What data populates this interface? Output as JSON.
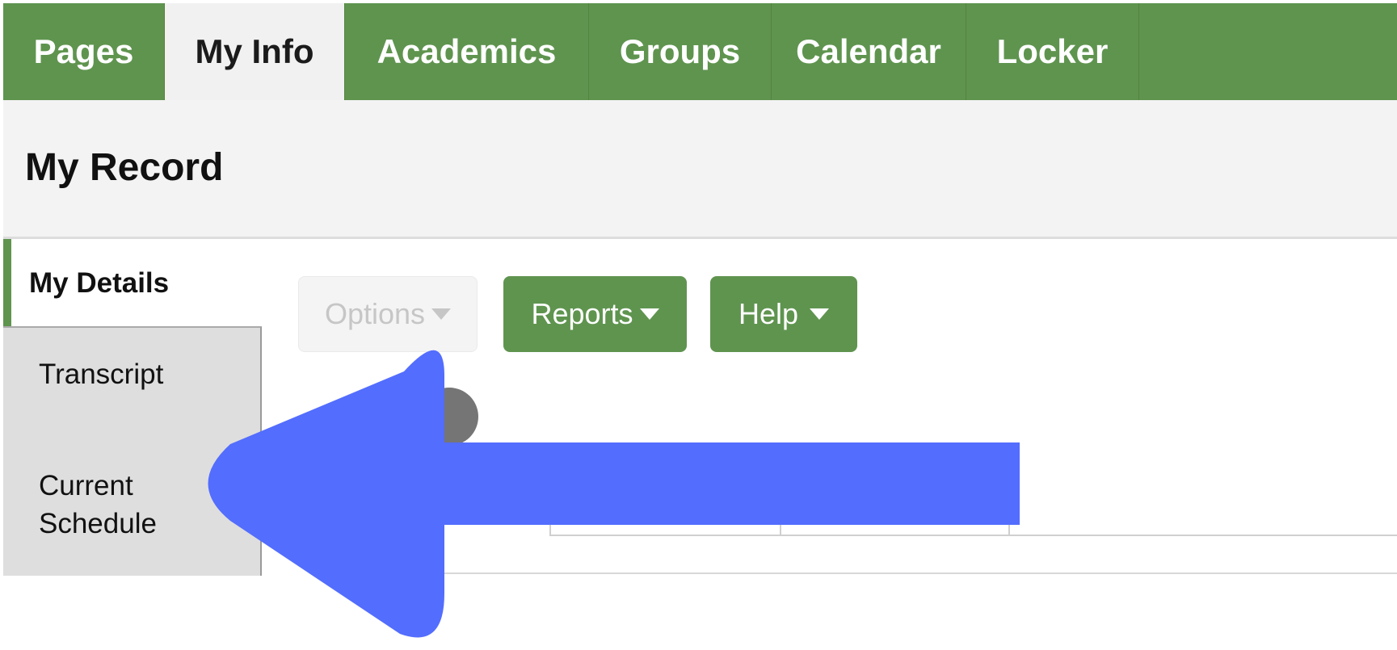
{
  "topnav": {
    "tabs": [
      {
        "label": "Pages"
      },
      {
        "label": "My Info"
      },
      {
        "label": "Academics"
      },
      {
        "label": "Groups"
      },
      {
        "label": "Calendar"
      },
      {
        "label": "Locker"
      }
    ]
  },
  "header": {
    "title": "My Record"
  },
  "sidebar": {
    "items": [
      {
        "label": "My Details"
      },
      {
        "label": "Transcript"
      },
      {
        "label": "Current Schedule"
      }
    ]
  },
  "toolbar": {
    "options_label": "Options",
    "reports_label": "Reports",
    "help_label": "Help"
  },
  "annotation": {
    "arrow_color": "#536dfe",
    "direction": "left"
  },
  "colors": {
    "brand_green": "#5f944f",
    "header_bg": "#f3f3f3",
    "sidebar_bg": "#dedede"
  }
}
